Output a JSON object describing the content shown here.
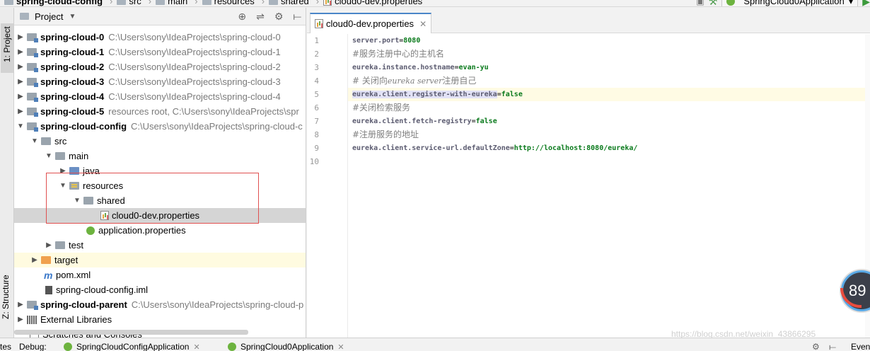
{
  "breadcrumbs": [
    {
      "label": "spring-cloud-config",
      "bold": true
    },
    {
      "label": "src"
    },
    {
      "label": "main"
    },
    {
      "label": "resources"
    },
    {
      "label": "shared"
    },
    {
      "label": "cloud0-dev.properties"
    }
  ],
  "run_config": {
    "label": "SpringCloud0Application"
  },
  "left_strip": {
    "project_tab": "1: Project",
    "structure_tab": "Z: Structure"
  },
  "project_panel": {
    "title": "Project",
    "tree": [
      {
        "name": "spring-cloud-0",
        "path": "C:\\Users\\sony\\IdeaProjects\\spring-cloud-0"
      },
      {
        "name": "spring-cloud-1",
        "path": "C:\\Users\\sony\\IdeaProjects\\spring-cloud-1"
      },
      {
        "name": "spring-cloud-2",
        "path": "C:\\Users\\sony\\IdeaProjects\\spring-cloud-2"
      },
      {
        "name": "spring-cloud-3",
        "path": "C:\\Users\\sony\\IdeaProjects\\spring-cloud-3"
      },
      {
        "name": "spring-cloud-4",
        "path": "C:\\Users\\sony\\IdeaProjects\\spring-cloud-4"
      },
      {
        "name": "spring-cloud-5",
        "path": "resources root, C:\\Users\\sony\\IdeaProjects\\spr"
      },
      {
        "name": "spring-cloud-config",
        "path": "C:\\Users\\sony\\IdeaProjects\\spring-cloud-c"
      },
      {
        "name": "src"
      },
      {
        "name": "main"
      },
      {
        "name": "java"
      },
      {
        "name": "resources"
      },
      {
        "name": "shared"
      },
      {
        "name": "cloud0-dev.properties"
      },
      {
        "name": "application.properties"
      },
      {
        "name": "test"
      },
      {
        "name": "target"
      },
      {
        "name": "pom.xml"
      },
      {
        "name": "spring-cloud-config.iml"
      },
      {
        "name": "spring-cloud-parent",
        "path": "C:\\Users\\sony\\IdeaProjects\\spring-cloud-p"
      },
      {
        "name": "External Libraries"
      },
      {
        "name": "Scratches and Consoles"
      }
    ]
  },
  "editor": {
    "tab_label": "cloud0-dev.properties",
    "line_numbers": [
      "1",
      "2",
      "3",
      "4",
      "5",
      "6",
      "7",
      "8",
      "9",
      "10"
    ],
    "lines": [
      {
        "key": "server.port",
        "value": "8080"
      },
      {
        "comment": "#服务注册中心的主机名"
      },
      {
        "key": "eureka.instance.hostname",
        "value": "evan-yu"
      },
      {
        "comment_a": "# 关闭向",
        "comment_i": "eureka server",
        "comment_b": "注册自己"
      },
      {
        "key": "eureka.client.register-with-eureka",
        "value": "false"
      },
      {
        "comment": "#关闭检索服务"
      },
      {
        "key": "eureka.client.fetch-registry",
        "value": "false"
      },
      {
        "comment": "#注册服务的地址"
      },
      {
        "key": "eureka.client.service-url.defaultZone",
        "value": "http://localhost:8080/eureka/"
      },
      {}
    ]
  },
  "badge": {
    "value": "89"
  },
  "watermark": "https://blog.csdn.net/weixin_43866295",
  "bottom_bar": {
    "debug_label": "Debug:",
    "tab1": "SpringCloudConfigApplication",
    "tab2": "SpringCloud0Application",
    "left_text": "tes",
    "right_text": "Even"
  },
  "colors": {
    "value_green": "#0a7a1c",
    "selection_red": "#e05050",
    "accent_blue": "#4a86c8"
  }
}
